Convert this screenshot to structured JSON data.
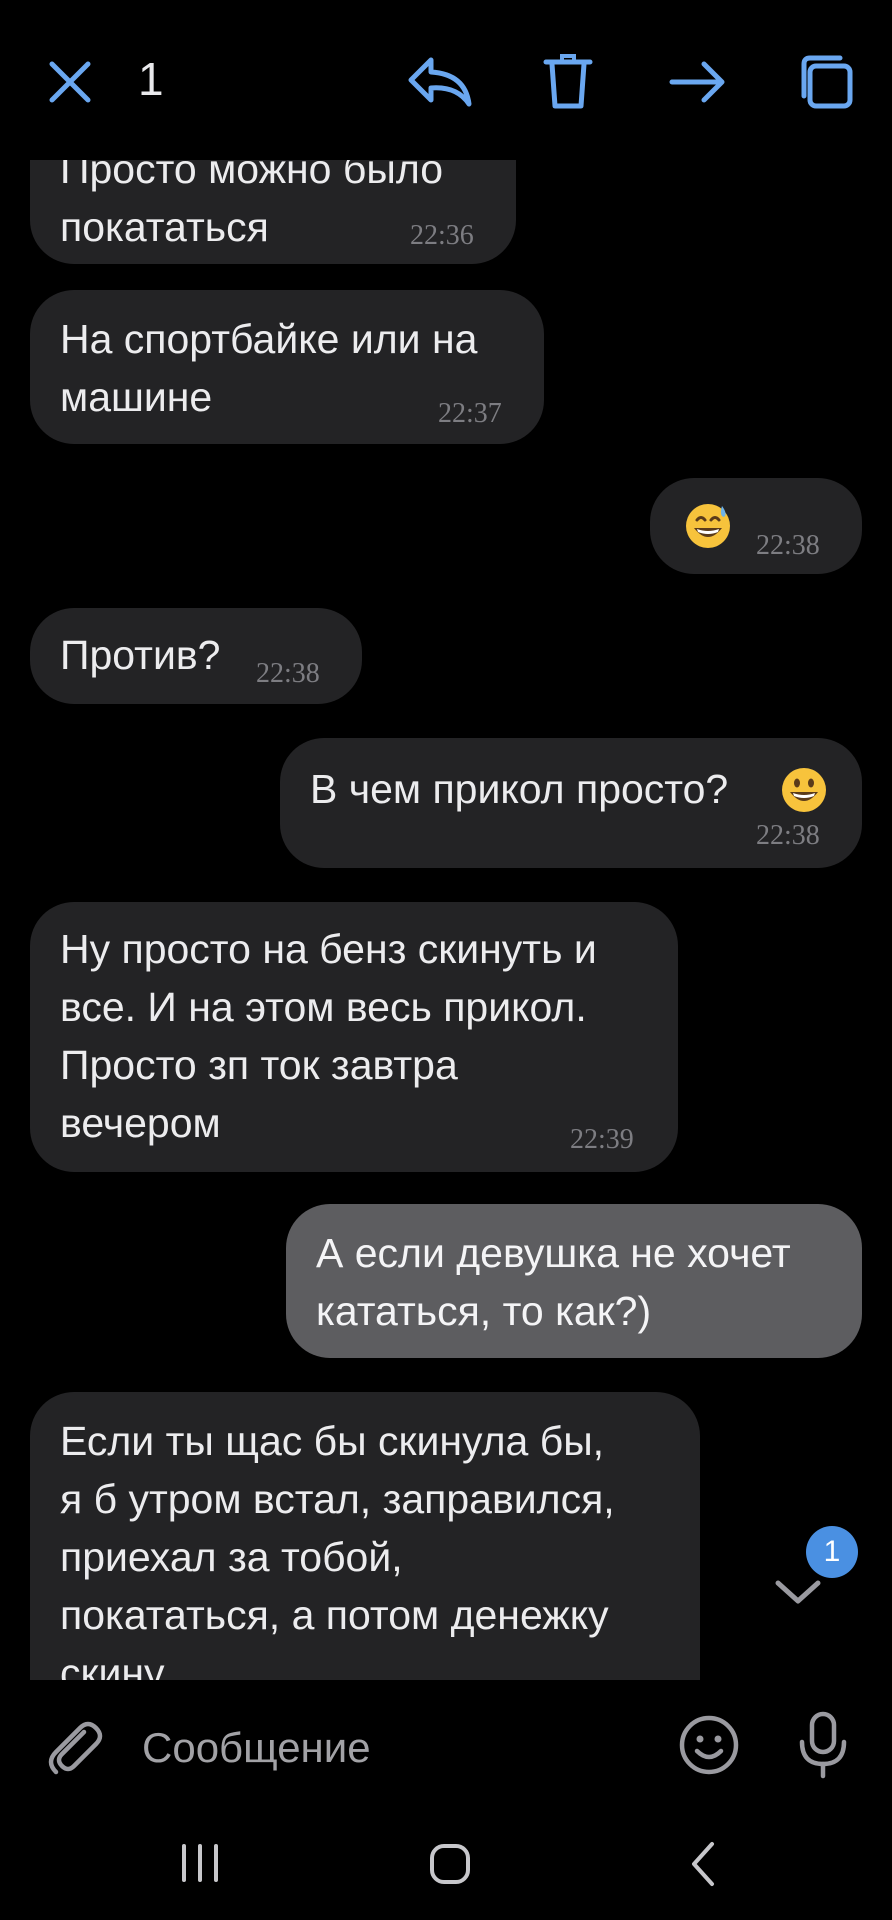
{
  "selection_bar": {
    "count": "1",
    "icons": [
      "close-icon",
      "reply-icon",
      "delete-icon",
      "forward-icon",
      "copy-icon"
    ],
    "accent_color": "#6aa7f0"
  },
  "messages": [
    {
      "direction": "in",
      "text": "Просто можно было\nпокататься",
      "time": "22:36"
    },
    {
      "direction": "in",
      "text": "На спортбайке или на\nмашине",
      "time": "22:37"
    },
    {
      "direction": "out",
      "emoji": "grinning-sweat-emoji",
      "time": "22:38"
    },
    {
      "direction": "in",
      "text": "Против?",
      "time": "22:38"
    },
    {
      "direction": "out",
      "text": "В чем прикол просто?",
      "emoji": "grinning-emoji",
      "time": "22:38"
    },
    {
      "direction": "in",
      "text": "Ну просто на бенз скинуть и\nвсе. И на этом весь прикол.\nПросто зп ток завтра\nвечером",
      "time": "22:39"
    },
    {
      "direction": "out",
      "selected": true,
      "text": "А если девушка не хочет\nкататься, то как?)"
    },
    {
      "direction": "in",
      "text": "Если ты щас бы скинула бы,\nя б утром встал, заправился,\nприехал за тобой,\nпокататься, а потом денежку\nскину"
    }
  ],
  "jump_down": {
    "unread_count": "1"
  },
  "composer": {
    "placeholder": "Сообщение",
    "icons": [
      "attach-icon",
      "emoji-icon",
      "microphone-icon"
    ]
  },
  "system_nav": {
    "icons": [
      "recents-icon",
      "home-icon",
      "back-icon"
    ]
  }
}
